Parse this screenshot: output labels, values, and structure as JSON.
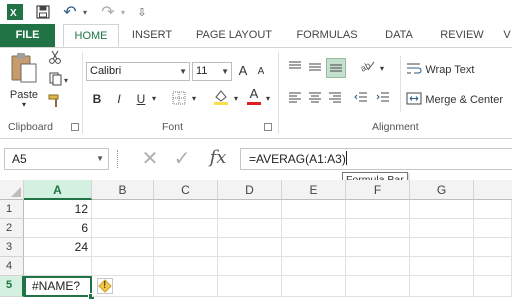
{
  "qat": {
    "undo": "↶",
    "redo": "↷",
    "customize": "⇩"
  },
  "tabs": {
    "file": "FILE",
    "home": "HOME",
    "insert": "INSERT",
    "page_layout": "PAGE LAYOUT",
    "formulas": "FORMULAS",
    "data": "DATA",
    "review": "REVIEW",
    "view_partial": "V"
  },
  "ribbon": {
    "clipboard": {
      "paste": "Paste",
      "label": "Clipboard"
    },
    "font": {
      "name": "Calibri",
      "size": "11",
      "grow": "A",
      "shrink": "A",
      "bold": "B",
      "italic": "I",
      "underline": "U",
      "font_color": "A",
      "label": "Font"
    },
    "alignment": {
      "wrap_text": "Wrap Text",
      "merge_center": "Merge & Center",
      "label": "Alignment"
    }
  },
  "formula_bar": {
    "name_box": "A5",
    "cancel": "✕",
    "enter": "✓",
    "fx": "fx",
    "formula": "=AVERAG(A1:A3)",
    "tooltip": "Formula Bar"
  },
  "grid": {
    "columns": [
      "A",
      "B",
      "C",
      "D",
      "E",
      "F",
      "G"
    ],
    "rows": [
      "1",
      "2",
      "3",
      "4",
      "5"
    ],
    "cells": {
      "A1": "12",
      "A2": "6",
      "A3": "24",
      "A4": "",
      "A5": "#NAME?"
    },
    "error_badge": "!"
  },
  "colors": {
    "accent": "#217346",
    "error_icon": "#f2c94c"
  }
}
